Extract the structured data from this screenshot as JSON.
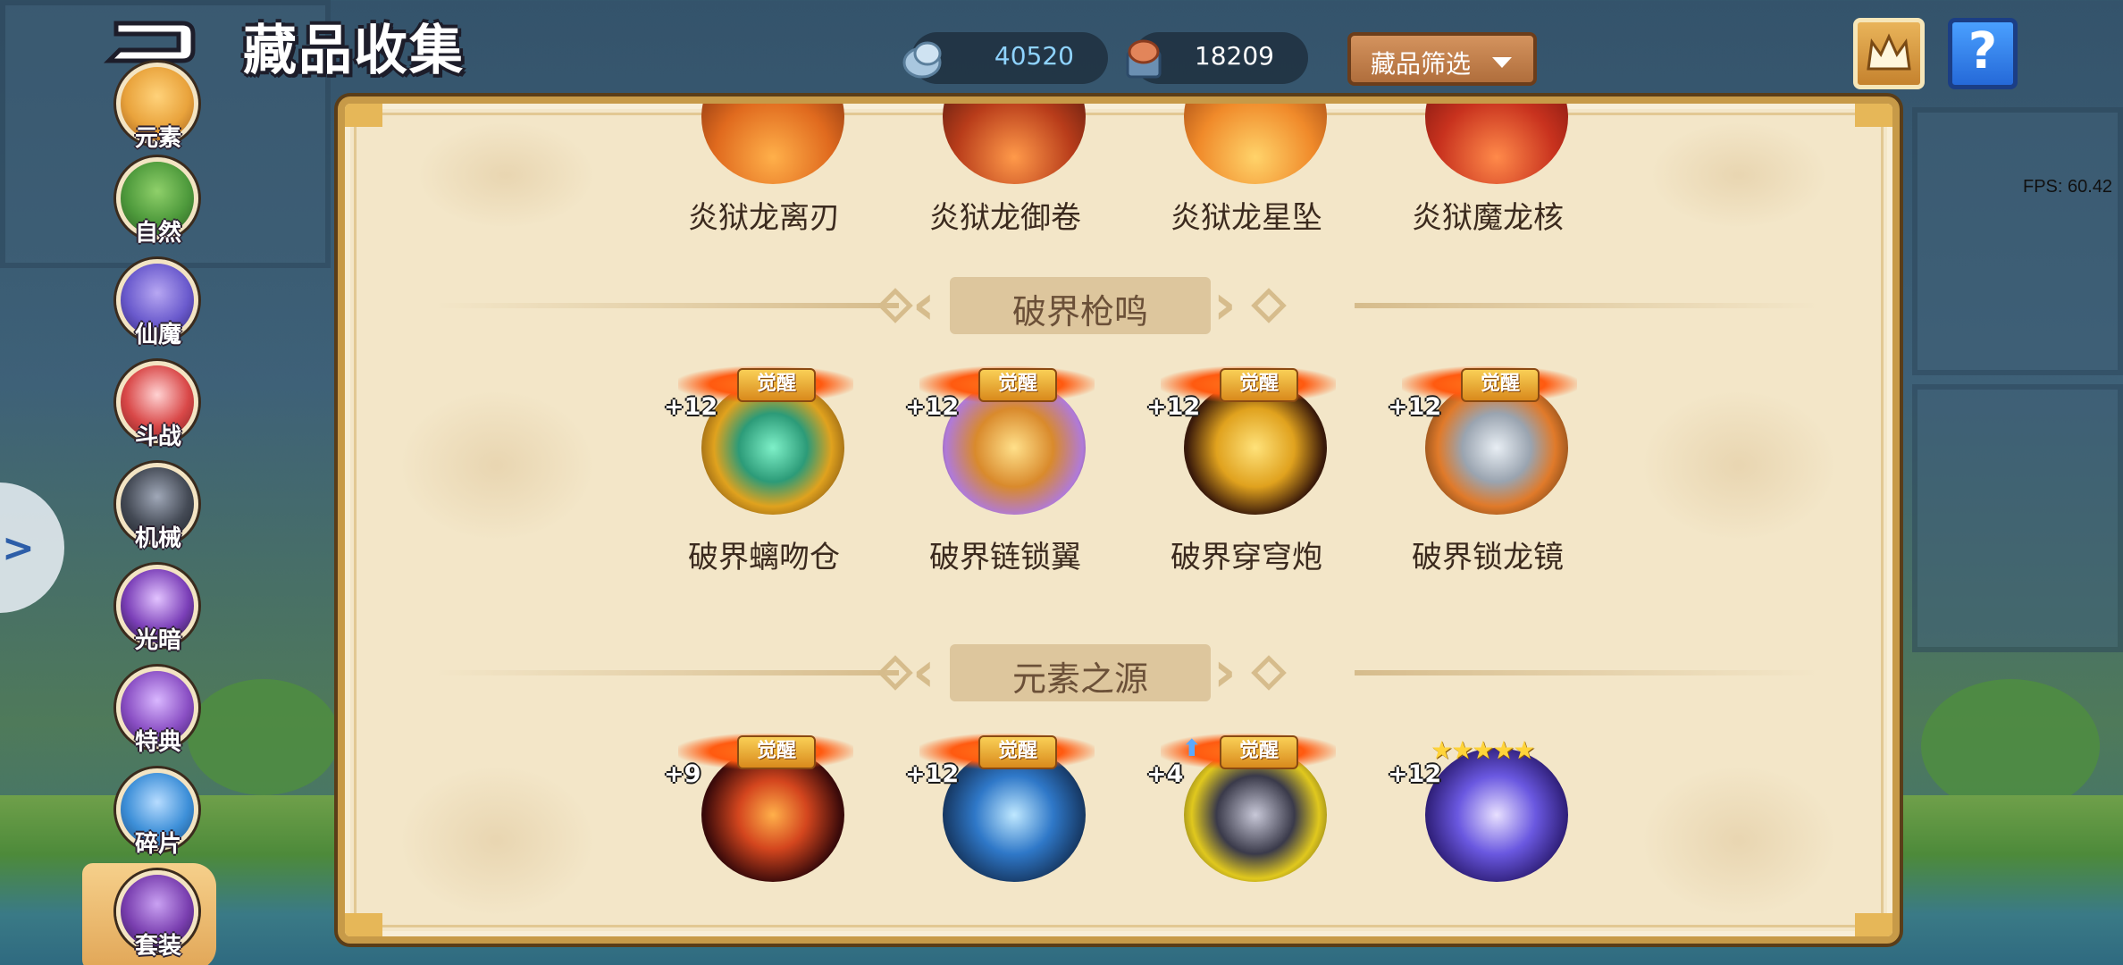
{
  "header": {
    "title": "藏品收集",
    "currency_1": "40520",
    "currency_2": "18209",
    "filter_label": "藏品筛选",
    "help_label": "?"
  },
  "fps": "FPS: 60.42",
  "sidebar": {
    "items": [
      {
        "label": "元素",
        "color": "#e9a33c"
      },
      {
        "label": "自然",
        "color": "#4e9a3c"
      },
      {
        "label": "仙魔",
        "color": "#6a5acd"
      },
      {
        "label": "斗战",
        "color": "#d94848"
      },
      {
        "label": "机械",
        "color": "#444a55"
      },
      {
        "label": "光暗",
        "color": "#7b3fb8"
      },
      {
        "label": "特典",
        "color": "#8a4fc4"
      },
      {
        "label": "碎片",
        "color": "#3d8fd8"
      },
      {
        "label": "套装",
        "color": "#7a3fb0"
      }
    ],
    "active": "套装"
  },
  "top_row": {
    "items": [
      {
        "name": "炎狱龙离刃",
        "color": "#e06a1e"
      },
      {
        "name": "炎狱龙御卷",
        "color": "#b83c1a"
      },
      {
        "name": "炎狱龙星坠",
        "color": "#f08a2a"
      },
      {
        "name": "炎狱魔龙核",
        "color": "#c8321e"
      }
    ]
  },
  "sections": [
    {
      "title": "破界枪鸣",
      "items": [
        {
          "name": "破界螭吻仓",
          "level": "+12",
          "badge": "觉醒",
          "color": "#2c9b78"
        },
        {
          "name": "破界链锁翼",
          "level": "+12",
          "badge": "觉醒",
          "color": "#d98a2c"
        },
        {
          "name": "破界穿穹炮",
          "level": "+12",
          "badge": "觉醒",
          "color": "#e0a21e"
        },
        {
          "name": "破界锁龙镜",
          "level": "+12",
          "badge": "觉醒",
          "color": "#9aa4b0"
        }
      ]
    },
    {
      "title": "元素之源",
      "items": [
        {
          "level": "+9",
          "badge": "觉醒",
          "color": "#d4461e"
        },
        {
          "level": "+12",
          "badge": "觉醒",
          "color": "#2f78c8"
        },
        {
          "level": "+4",
          "badge": "觉醒",
          "color": "#3a3a4a",
          "upgrade_arrow": true
        },
        {
          "level": "+12",
          "stars": "★★★★★",
          "color": "#6a58e0"
        }
      ]
    }
  ]
}
